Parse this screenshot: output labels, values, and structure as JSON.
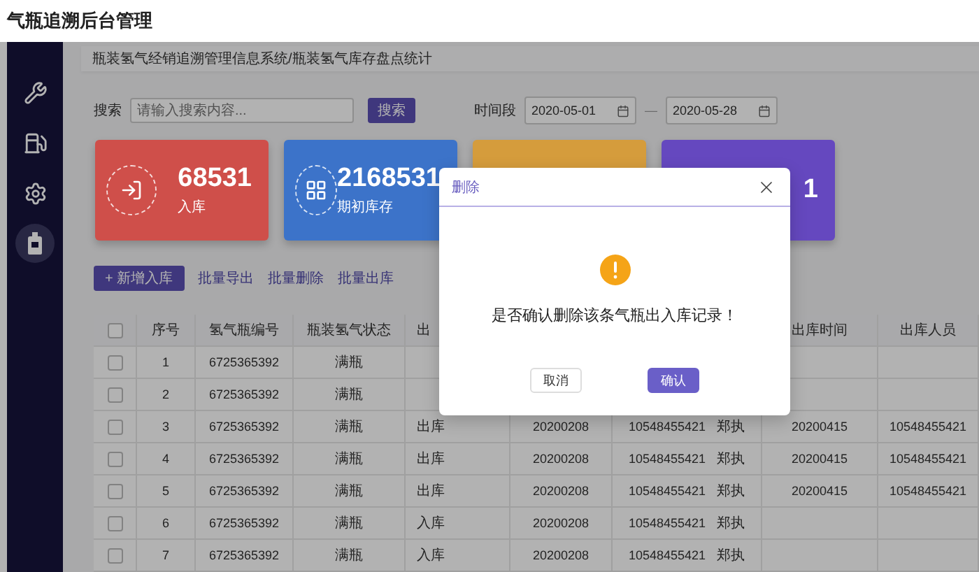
{
  "app_title": "气瓶追溯后台管理",
  "sidebar": {
    "items": [
      {
        "selected": false
      },
      {
        "selected": false
      },
      {
        "selected": false
      },
      {
        "selected": true
      }
    ]
  },
  "breadcrumb": "瓶装氢气经销追溯管理信息系统/瓶装氢气库存盘点统计",
  "search": {
    "label": "搜索",
    "placeholder": "请输入搜索内容...",
    "button": "搜索"
  },
  "date_range": {
    "label": "时间段",
    "start": "2020-05-01",
    "separator": "—",
    "end": "2020-05-28"
  },
  "stat_cards": [
    {
      "value": "68531",
      "label": "入库",
      "color": "#cf4f4a"
    },
    {
      "value": "2168531",
      "label": "期初库存",
      "color": "#3c73c9"
    },
    {
      "color": "#d59c3c"
    },
    {
      "value": "1",
      "color": "#6548bf"
    }
  ],
  "actions": [
    {
      "kind": "primary",
      "label": "+ 新增入库"
    },
    {
      "kind": "link",
      "label": "批量导出"
    },
    {
      "kind": "link",
      "label": "批量删除"
    },
    {
      "kind": "link",
      "label": "批量出库"
    }
  ],
  "table": {
    "header_checked": false,
    "columns": [
      {
        "label": "序号"
      },
      {
        "label": "氢气瓶编号"
      },
      {
        "label": "瓶装氢气状态"
      },
      {
        "label": "出"
      },
      {},
      {},
      {
        "label": "出库时间"
      },
      {
        "label": "出库人员"
      }
    ],
    "rows": [
      {
        "checked": false,
        "cells": [
          "1",
          "6725365392",
          "满瓶"
        ]
      },
      {
        "checked": false,
        "cells": [
          "2",
          "6725365392",
          "满瓶"
        ]
      },
      {
        "checked": false,
        "cells": [
          "3",
          "6725365392",
          "满瓶",
          "出库",
          "20200208",
          [
            "10548455421",
            "郑执"
          ],
          "20200415",
          "10548455421"
        ]
      },
      {
        "checked": false,
        "cells": [
          "4",
          "6725365392",
          "满瓶",
          "出库",
          "20200208",
          [
            "10548455421",
            "郑执"
          ],
          "20200415",
          "10548455421"
        ]
      },
      {
        "checked": false,
        "cells": [
          "5",
          "6725365392",
          "满瓶",
          "出库",
          "20200208",
          [
            "10548455421",
            "郑执"
          ],
          "20200415",
          "10548455421"
        ]
      },
      {
        "checked": false,
        "cells": [
          "6",
          "6725365392",
          "满瓶",
          "入库",
          "20200208",
          [
            "10548455421",
            "郑执"
          ]
        ]
      },
      {
        "checked": false,
        "cells": [
          "7",
          "6725365392",
          "满瓶",
          "入库",
          "20200208",
          [
            "10548455421",
            "郑执"
          ]
        ]
      }
    ]
  },
  "modal": {
    "title": "删除",
    "message": "是否确认删除该条气瓶出入库记录！",
    "buttons": [
      {
        "kind": "secondary",
        "label": "取消"
      },
      {
        "kind": "primary",
        "label": "确认"
      }
    ]
  }
}
